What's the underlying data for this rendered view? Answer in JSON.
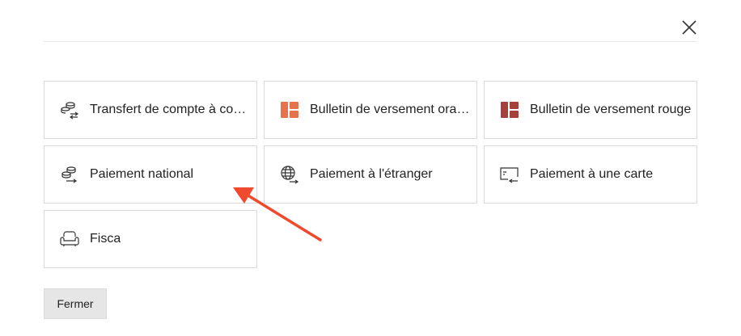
{
  "dialog": {
    "close_icon": "close-icon",
    "tiles": [
      {
        "label": "Transfert de compte à compte",
        "icon": "coins-transfer-icon"
      },
      {
        "label": "Bulletin de versement orange",
        "icon": "layout-orange-icon",
        "accent": "#e8734a"
      },
      {
        "label": "Bulletin de versement rouge",
        "icon": "layout-red-icon",
        "accent": "#a5413a"
      },
      {
        "label": "Paiement national",
        "icon": "coins-arrow-icon"
      },
      {
        "label": "Paiement à l'étranger",
        "icon": "globe-arrow-icon"
      },
      {
        "label": "Paiement à une carte",
        "icon": "card-arrow-icon"
      },
      {
        "label": "Fisca",
        "icon": "armchair-icon"
      }
    ],
    "close_button_label": "Fermer"
  },
  "annotation": {
    "color": "#f04a2e",
    "target": "Paiement national"
  }
}
